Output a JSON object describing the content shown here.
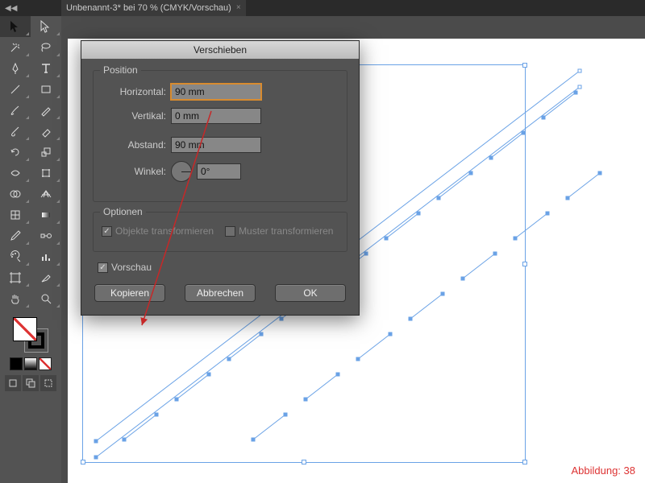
{
  "app": {
    "collapse_glyph": "◀◀",
    "document_tab": "Unbenannt-3* bei 70 % (CMYK/Vorschau)",
    "tab_close_glyph": "×"
  },
  "dialog": {
    "title": "Verschieben",
    "position": {
      "legend": "Position",
      "horizontal_label": "Horizontal:",
      "horizontal_value": "90 mm",
      "vertical_label": "Vertikal:",
      "vertical_value": "0 mm",
      "distance_label": "Abstand:",
      "distance_value": "90 mm",
      "angle_label": "Winkel:",
      "angle_value": "0°"
    },
    "options": {
      "legend": "Optionen",
      "transform_objects": "Objekte transformieren",
      "transform_patterns": "Muster transformieren",
      "transform_objects_checked": true,
      "transform_patterns_checked": false
    },
    "preview_label": "Vorschau",
    "preview_checked": true,
    "buttons": {
      "copy": "Kopieren",
      "cancel": "Abbrechen",
      "ok": "OK"
    }
  },
  "caption": "Abbildung: 38",
  "tools": [
    "selection",
    "direct-selection",
    "magic-wand",
    "lasso",
    "pen",
    "type",
    "line",
    "rectangle",
    "paintbrush",
    "pencil",
    "blob-brush",
    "eraser",
    "rotate",
    "scale",
    "width",
    "warp",
    "shape-builder",
    "perspective",
    "mesh",
    "gradient",
    "eyedropper",
    "blend",
    "symbol-sprayer",
    "graph",
    "artboard",
    "slice",
    "hand",
    "zoom"
  ],
  "colors": {
    "selection": "#6aa2e6",
    "dialog_bg": "#535353",
    "accent": "#d88b2f",
    "annotation": "#c62828"
  }
}
